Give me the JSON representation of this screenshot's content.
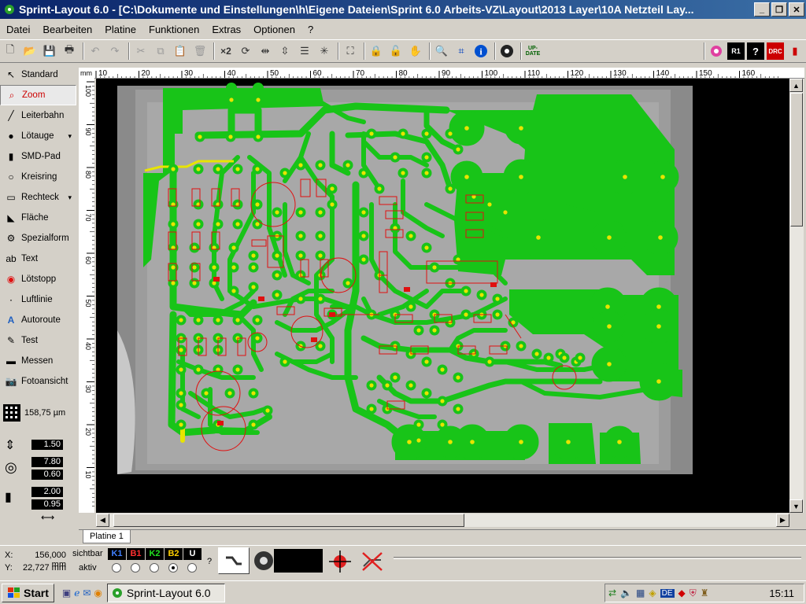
{
  "window": {
    "title": "Sprint-Layout 6.0 - [C:\\Dokumente und Einstellungen\\h\\Eigene Dateien\\Sprint 6.0 Arbeits-VZ\\Layout\\2013 Layer\\10A Netzteil Lay..."
  },
  "menu": [
    "Datei",
    "Bearbeiten",
    "Platine",
    "Funktionen",
    "Extras",
    "Optionen",
    "?"
  ],
  "toolbar": {
    "x2": "×2",
    "update": "UP-\nDATE",
    "r1": "R1",
    "drc": "DRC"
  },
  "tools": [
    {
      "label": "Standard",
      "icon": "arrow-icon"
    },
    {
      "label": "Zoom",
      "icon": "magnifier-icon"
    },
    {
      "label": "Leiterbahn",
      "icon": "track-icon"
    },
    {
      "label": "Lötauge",
      "icon": "pad-icon"
    },
    {
      "label": "SMD-Pad",
      "icon": "smd-pad-icon"
    },
    {
      "label": "Kreisring",
      "icon": "ring-icon"
    },
    {
      "label": "Rechteck",
      "icon": "rectangle-icon"
    },
    {
      "label": "Fläche",
      "icon": "area-icon"
    },
    {
      "label": "Spezialform",
      "icon": "special-shape-icon"
    },
    {
      "label": "Text",
      "icon": "text-icon"
    },
    {
      "label": "Lötstopp",
      "icon": "solder-stop-icon"
    },
    {
      "label": "Luftlinie",
      "icon": "airwire-icon"
    },
    {
      "label": "Autoroute",
      "icon": "autoroute-icon"
    },
    {
      "label": "Test",
      "icon": "test-icon"
    },
    {
      "label": "Messen",
      "icon": "measure-icon"
    },
    {
      "label": "Fotoansicht",
      "icon": "camera-icon"
    }
  ],
  "grid": {
    "value": "158,75 µm"
  },
  "widths": {
    "track": "1.50",
    "pad_outer": "7.80",
    "pad_inner": "0.60",
    "smd_w": "2.00",
    "smd_h": "0.95"
  },
  "ruler": {
    "unit": "mm",
    "top_ticks": [
      "10",
      "20",
      "30",
      "40",
      "50",
      "60",
      "70",
      "80",
      "90",
      "100",
      "110",
      "120",
      "130",
      "140",
      "150",
      "160"
    ],
    "left_ticks": [
      "100",
      "90",
      "80",
      "70",
      "60",
      "50",
      "40",
      "30",
      "20",
      "10"
    ]
  },
  "tab": "Platine 1",
  "status": {
    "x_label": "X:",
    "x_value": "156,000 mm",
    "y_label": "Y:",
    "y_value": "22,727 mm",
    "sichtbar": "sichtbar",
    "aktiv": "aktiv",
    "question": "?",
    "layers": [
      {
        "name": "K1",
        "color": "#4080ff"
      },
      {
        "name": "B1",
        "color": "#ff3030"
      },
      {
        "name": "K2",
        "color": "#20e020"
      },
      {
        "name": "B2",
        "color": "#ffd000"
      },
      {
        "name": "U",
        "color": "#ffffff"
      }
    ],
    "active_layer_index": 3
  },
  "taskbar": {
    "start": "Start",
    "task": "Sprint-Layout 6.0",
    "clock": "15:11",
    "lang": "DE"
  },
  "colors": {
    "copper": "#18c418",
    "pad_hole": "#e8e400",
    "component": "#e01010",
    "canvas": "#000000"
  }
}
